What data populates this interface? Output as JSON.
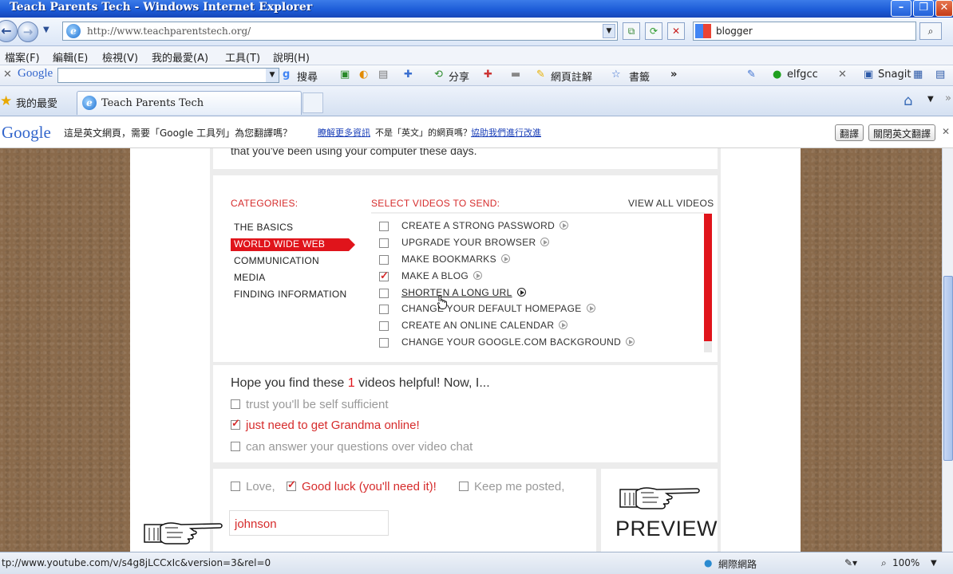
{
  "window": {
    "title": "Teach Parents Tech - Windows Internet Explorer"
  },
  "address": {
    "url": "http://www.teachparentstech.org/",
    "search_value": "blogger"
  },
  "menu": [
    "檔案(F)",
    "編輯(E)",
    "檢視(V)",
    "我的最愛(A)",
    "工具(T)",
    "說明(H)"
  ],
  "gtoolbar": {
    "brand": "Google",
    "search_label": "搜尋",
    "share_label": "分享",
    "notes_label": "網頁註解",
    "bookmarks_label": "書籤",
    "account": "elfgcc",
    "snagit": "Snagit"
  },
  "favorites": {
    "label": "我的最愛",
    "tab_title": "Teach Parents Tech"
  },
  "translate": {
    "logo": "Google",
    "message": "這是英文網頁，需要「Google 工具列」為您翻譯嗎？",
    "learn_more": "瞭解更多資訊",
    "not_english": "不是「英文」的網頁嗎？",
    "help_fix": "協助我們進行改進",
    "translate_btn": "翻譯",
    "close_btn": "關閉英文翻譯"
  },
  "page": {
    "intro": "that you've been using your computer these days.",
    "categories_title": "CATEGORIES:",
    "select_title": "SELECT VIDEOS TO SEND:",
    "view_all": "VIEW ALL VIDEOS",
    "categories": [
      {
        "label": "THE BASICS",
        "selected": false
      },
      {
        "label": "WORLD WIDE WEB",
        "selected": true
      },
      {
        "label": "COMMUNICATION",
        "selected": false
      },
      {
        "label": "MEDIA",
        "selected": false
      },
      {
        "label": "FINDING INFORMATION",
        "selected": false
      }
    ],
    "videos": [
      {
        "label": "CREATE A STRONG PASSWORD",
        "checked": false
      },
      {
        "label": "UPGRADE YOUR BROWSER",
        "checked": false
      },
      {
        "label": "MAKE BOOKMARKS",
        "checked": false
      },
      {
        "label": "MAKE A BLOG",
        "checked": true
      },
      {
        "label": "SHORTEN A LONG URL",
        "checked": false
      },
      {
        "label": "CHANGE YOUR DEFAULT HOMEPAGE",
        "checked": false
      },
      {
        "label": "CREATE AN ONLINE CALENDAR",
        "checked": false
      },
      {
        "label": "CHANGE YOUR GOOGLE.COM BACKGROUND",
        "checked": false
      }
    ],
    "helpful_prefix": "Hope you find these ",
    "helpful_count": "1",
    "helpful_suffix": " videos helpful! Now, I...",
    "options": [
      {
        "label": "trust you'll be self sufficient",
        "checked": false
      },
      {
        "label": "just need to get Grandma online!",
        "checked": true
      },
      {
        "label": "can answer your questions over video chat",
        "checked": false
      }
    ],
    "signoffs": [
      {
        "label": "Love,",
        "checked": false
      },
      {
        "label": "Good luck (you'll need it)!",
        "checked": true
      },
      {
        "label": "Keep me posted,",
        "checked": false
      }
    ],
    "name_value": "johnson",
    "preview": "PREVIEW"
  },
  "status": {
    "url": "tp://www.youtube.com/v/s4g8jLCCxIc&version=3&rel=0",
    "zone": "網際網路",
    "zoom": "100%"
  },
  "colors": {
    "accent": "#e0141b",
    "title_bar": "#1b5ad6"
  }
}
